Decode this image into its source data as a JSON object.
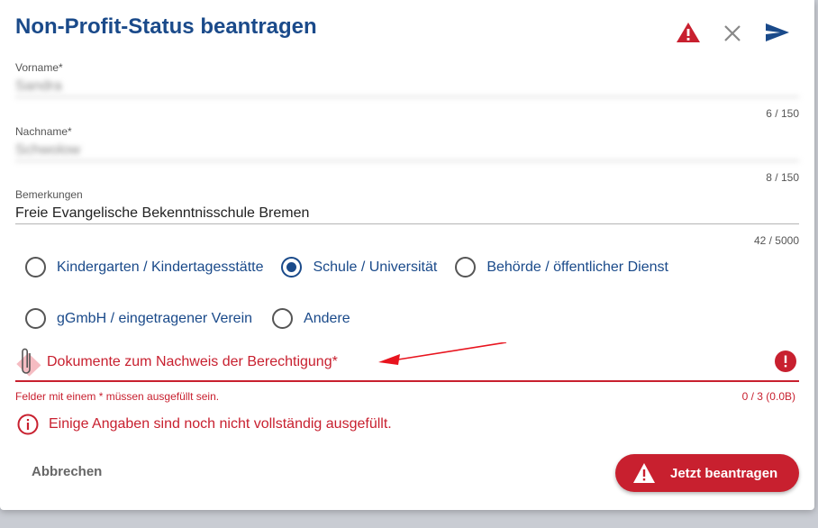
{
  "dialog": {
    "title": "Non-Profit-Status beantragen"
  },
  "icons": {
    "header": [
      "warning-icon",
      "close-icon",
      "send-icon"
    ],
    "attachment": "paperclip-icon",
    "error": "exclamation-circle-icon",
    "info": "info-circle-icon"
  },
  "fields": {
    "vorname": {
      "label": "Vorname*",
      "value": "Sandra",
      "counter": "6 / 150"
    },
    "nachname": {
      "label": "Nachname*",
      "value": "Schwolow",
      "counter": "8 / 150"
    },
    "bemerkungen": {
      "label": "Bemerkungen",
      "value": "Freie Evangelische Bekenntnisschule Bremen",
      "counter": "42 / 5000"
    }
  },
  "radios": {
    "options": [
      {
        "label": "Kindergarten / Kindertagesstätte",
        "checked": false
      },
      {
        "label": "Schule / Universität",
        "checked": true
      },
      {
        "label": "Behörde / öffentlicher Dienst",
        "checked": false
      },
      {
        "label": "gGmbH / eingetragener Verein",
        "checked": false
      },
      {
        "label": "Andere",
        "checked": false
      }
    ]
  },
  "upload": {
    "label": "Dokumente zum Nachweis der Berechtigung*",
    "helper": "Felder mit einem * müssen ausgefüllt sein.",
    "counter": "0 / 3 (0.0B)"
  },
  "alert": {
    "message": "Einige Angaben sind noch nicht vollständig ausgefüllt."
  },
  "footer": {
    "cancel": "Abbrechen",
    "submit": "Jetzt beantragen"
  },
  "colors": {
    "primary": "#1a4a8a",
    "error": "#c8202f"
  }
}
